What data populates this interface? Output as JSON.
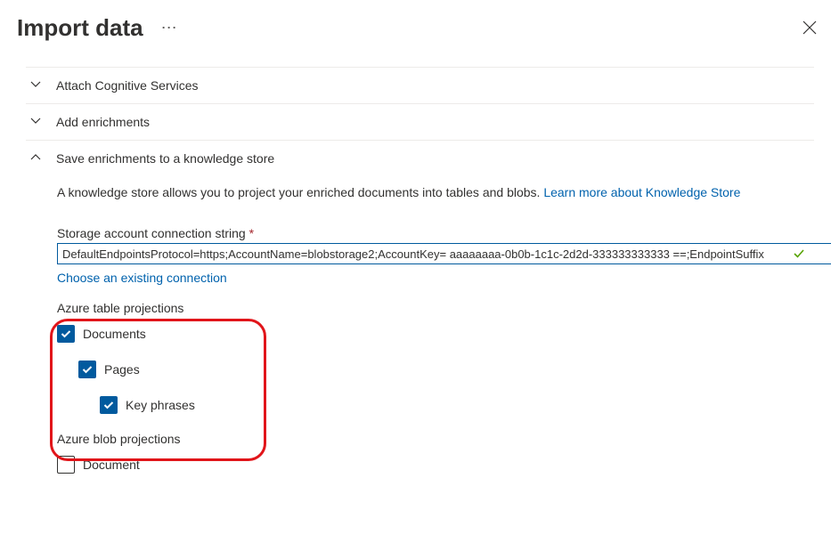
{
  "header": {
    "title": "Import data"
  },
  "accordions": {
    "attach": {
      "label": "Attach Cognitive Services"
    },
    "enrich": {
      "label": "Add enrichments"
    },
    "save": {
      "label": "Save enrichments to a knowledge store"
    }
  },
  "save_section": {
    "desc_prefix": "A knowledge store allows you to project your enriched documents into tables and blobs. ",
    "learn_link": "Learn more about Knowledge Store",
    "conn_label": "Storage account connection string ",
    "conn_value": "DefaultEndpointsProtocol=https;AccountName=blobstorage2;AccountKey= aaaaaaaa-0b0b-1c1c-2d2d-333333333333 ==;EndpointSuffix",
    "choose_link": "Choose an existing connection",
    "table_projections": {
      "heading": "Azure table projections",
      "documents": "Documents",
      "pages": "Pages",
      "key_phrases": "Key phrases"
    },
    "blob_projections": {
      "heading": "Azure blob projections",
      "document": "Document"
    }
  }
}
